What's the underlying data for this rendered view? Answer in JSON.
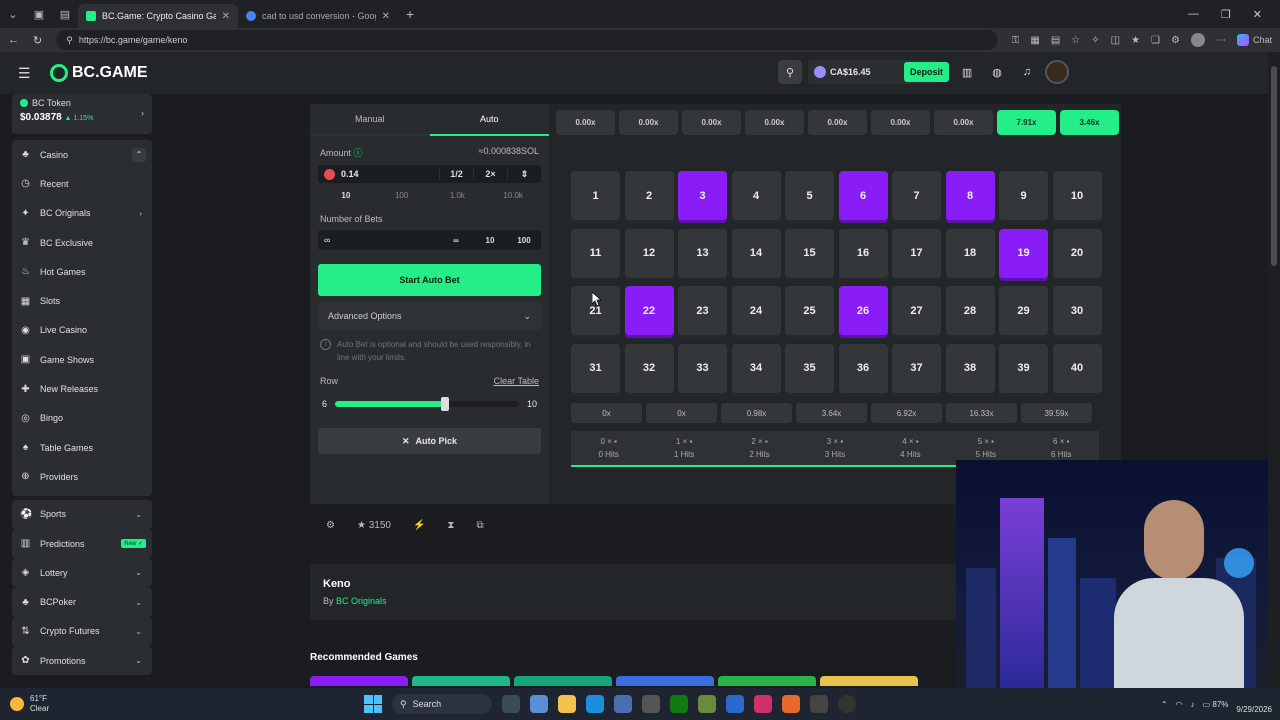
{
  "browser": {
    "tabs": [
      {
        "title": "BC.Game: Crypto Casino Gam",
        "active": true
      },
      {
        "title": "cad to usd conversion - Google S",
        "active": false
      }
    ],
    "url": "https://bc.game/game/keno",
    "chat_label": "Chat"
  },
  "header": {
    "logo": "BC.GAME",
    "balance": "CA$16.45",
    "deposit": "Deposit"
  },
  "sidebar": {
    "token": {
      "name": "BC Token",
      "price": "$0.03878",
      "change": "1.15%"
    },
    "casino_label": "Casino",
    "casino_items": [
      {
        "label": "Recent",
        "icon": "clock-icon",
        "glyph": "◷"
      },
      {
        "label": "BC Originals",
        "icon": "star-icon",
        "glyph": "✦",
        "chevron": true
      },
      {
        "label": "BC Exclusive",
        "icon": "crown-icon",
        "glyph": "♛"
      },
      {
        "label": "Hot Games",
        "icon": "fire-icon",
        "glyph": "♨"
      },
      {
        "label": "Slots",
        "icon": "slot-icon",
        "glyph": "▦"
      },
      {
        "label": "Live Casino",
        "icon": "live-icon",
        "glyph": "◉"
      },
      {
        "label": "Game Shows",
        "icon": "tv-icon",
        "glyph": "▣"
      },
      {
        "label": "New Releases",
        "icon": "new-icon",
        "glyph": "✚"
      },
      {
        "label": "Bingo",
        "icon": "bingo-icon",
        "glyph": "◎"
      },
      {
        "label": "Table Games",
        "icon": "cards-icon",
        "glyph": "♠"
      },
      {
        "label": "Providers",
        "icon": "providers-icon",
        "glyph": "⊕"
      }
    ],
    "other_items": [
      {
        "label": "Sports",
        "icon": "ball-icon",
        "glyph": "⚽",
        "tail": "⌄"
      },
      {
        "label": "Predictions",
        "icon": "predictions-icon",
        "glyph": "▥",
        "badge": "New ✓"
      },
      {
        "label": "Lottery",
        "icon": "lottery-icon",
        "glyph": "◈",
        "tail": "⌄"
      },
      {
        "label": "BCPoker",
        "icon": "poker-icon",
        "glyph": "♣",
        "tail": "⌄"
      },
      {
        "label": "Crypto Futures",
        "icon": "futures-icon",
        "glyph": "⇅",
        "tail": "⌄"
      },
      {
        "label": "Promotions",
        "icon": "gift-icon",
        "glyph": "✿",
        "tail": "⌄"
      }
    ]
  },
  "controls": {
    "tabs": [
      "Manual",
      "Auto"
    ],
    "amount_label": "Amount",
    "amount_sol": "≈0.000838SOL",
    "amount_value": "0.14",
    "half": "1/2",
    "double": "2×",
    "quick_amounts": [
      "10",
      "100",
      "1.0k",
      "10.0k"
    ],
    "bets_label": "Number of Bets",
    "bets_value": "∞",
    "bets_options": [
      "∞",
      "10",
      "100"
    ],
    "start_label": "Start Auto Bet",
    "advanced_label": "Advanced Options",
    "note": "Auto Bet is optional and should be used responsibly, in line with your limits.",
    "row_label": "Row",
    "clear_table": "Clear Table",
    "row_min": "6",
    "row_max": "10",
    "row_fraction": 0.6,
    "auto_pick": "Auto Pick"
  },
  "multipliers": [
    "0.00x",
    "0.00x",
    "0.00x",
    "0.00x",
    "0.00x",
    "0.00x",
    "0.00x",
    "7.91x",
    "3.46x"
  ],
  "multipliers_win": [
    false,
    false,
    false,
    false,
    false,
    false,
    false,
    true,
    true
  ],
  "numbers": [
    1,
    2,
    3,
    4,
    5,
    6,
    7,
    8,
    9,
    10,
    11,
    12,
    13,
    14,
    15,
    16,
    17,
    18,
    19,
    20,
    21,
    22,
    23,
    24,
    25,
    26,
    27,
    28,
    29,
    30,
    31,
    32,
    33,
    34,
    35,
    36,
    37,
    38,
    39,
    40
  ],
  "selected": [
    3,
    6,
    8,
    19,
    22,
    26
  ],
  "payouts": [
    "0x",
    "0x",
    "0.98x",
    "3.64x",
    "6.92x",
    "16.33x",
    "39.59x"
  ],
  "hits": [
    {
      "top": "0 ×",
      "bottom": "0 Hits"
    },
    {
      "top": "1 ×",
      "bottom": "1 Hits"
    },
    {
      "top": "2 ×",
      "bottom": "2 Hits"
    },
    {
      "top": "3 ×",
      "bottom": "3 Hits"
    },
    {
      "top": "4 ×",
      "bottom": "4 Hits"
    },
    {
      "top": "5 ×",
      "bottom": "5 Hits"
    },
    {
      "top": "6 ×",
      "bottom": "6 Hits"
    }
  ],
  "game_toolbar": {
    "likes": "3150"
  },
  "info": {
    "title": "Keno",
    "by_prefix": "By",
    "by_link": "BC Originals"
  },
  "recommended_label": "Recommended Games",
  "taskbar": {
    "temp": "61°F",
    "weather": "Clear",
    "search": "Search",
    "battery": "87%",
    "date": "9/29/2026"
  },
  "colors": {
    "accent": "#23ee88",
    "selected": "#8a1cf8",
    "panel": "#232628"
  }
}
